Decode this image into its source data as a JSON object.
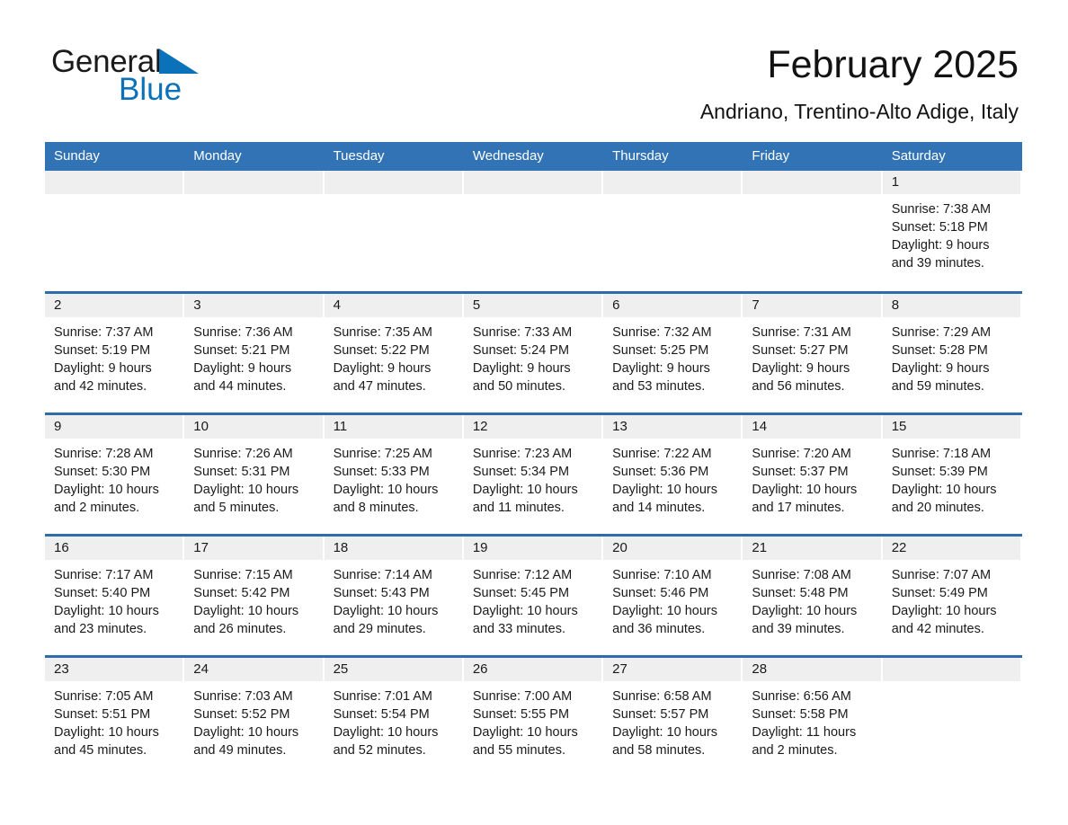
{
  "brand": {
    "name_part1": "General",
    "name_part2": "Blue",
    "triangle_color": "#0b71b8"
  },
  "header": {
    "title": "February 2025",
    "subtitle": "Andriano, Trentino-Alto Adige, Italy",
    "accent_color": "#3273b5",
    "row_rule_color": "#2e6da9",
    "daynum_band_color": "#efeff0"
  },
  "weekday_headers": [
    "Sunday",
    "Monday",
    "Tuesday",
    "Wednesday",
    "Thursday",
    "Friday",
    "Saturday"
  ],
  "labels": {
    "sunrise_prefix": "Sunrise:",
    "sunset_prefix": "Sunset:",
    "daylight_prefix": "Daylight:"
  },
  "weeks": [
    [
      {
        "blank": true
      },
      {
        "blank": true
      },
      {
        "blank": true
      },
      {
        "blank": true
      },
      {
        "blank": true
      },
      {
        "blank": true
      },
      {
        "day": "1",
        "sunrise": "Sunrise: 7:38 AM",
        "sunset": "Sunset: 5:18 PM",
        "daylight1": "Daylight: 9 hours",
        "daylight2": "and 39 minutes."
      }
    ],
    [
      {
        "day": "2",
        "sunrise": "Sunrise: 7:37 AM",
        "sunset": "Sunset: 5:19 PM",
        "daylight1": "Daylight: 9 hours",
        "daylight2": "and 42 minutes."
      },
      {
        "day": "3",
        "sunrise": "Sunrise: 7:36 AM",
        "sunset": "Sunset: 5:21 PM",
        "daylight1": "Daylight: 9 hours",
        "daylight2": "and 44 minutes."
      },
      {
        "day": "4",
        "sunrise": "Sunrise: 7:35 AM",
        "sunset": "Sunset: 5:22 PM",
        "daylight1": "Daylight: 9 hours",
        "daylight2": "and 47 minutes."
      },
      {
        "day": "5",
        "sunrise": "Sunrise: 7:33 AM",
        "sunset": "Sunset: 5:24 PM",
        "daylight1": "Daylight: 9 hours",
        "daylight2": "and 50 minutes."
      },
      {
        "day": "6",
        "sunrise": "Sunrise: 7:32 AM",
        "sunset": "Sunset: 5:25 PM",
        "daylight1": "Daylight: 9 hours",
        "daylight2": "and 53 minutes."
      },
      {
        "day": "7",
        "sunrise": "Sunrise: 7:31 AM",
        "sunset": "Sunset: 5:27 PM",
        "daylight1": "Daylight: 9 hours",
        "daylight2": "and 56 minutes."
      },
      {
        "day": "8",
        "sunrise": "Sunrise: 7:29 AM",
        "sunset": "Sunset: 5:28 PM",
        "daylight1": "Daylight: 9 hours",
        "daylight2": "and 59 minutes."
      }
    ],
    [
      {
        "day": "9",
        "sunrise": "Sunrise: 7:28 AM",
        "sunset": "Sunset: 5:30 PM",
        "daylight1": "Daylight: 10 hours",
        "daylight2": "and 2 minutes."
      },
      {
        "day": "10",
        "sunrise": "Sunrise: 7:26 AM",
        "sunset": "Sunset: 5:31 PM",
        "daylight1": "Daylight: 10 hours",
        "daylight2": "and 5 minutes."
      },
      {
        "day": "11",
        "sunrise": "Sunrise: 7:25 AM",
        "sunset": "Sunset: 5:33 PM",
        "daylight1": "Daylight: 10 hours",
        "daylight2": "and 8 minutes."
      },
      {
        "day": "12",
        "sunrise": "Sunrise: 7:23 AM",
        "sunset": "Sunset: 5:34 PM",
        "daylight1": "Daylight: 10 hours",
        "daylight2": "and 11 minutes."
      },
      {
        "day": "13",
        "sunrise": "Sunrise: 7:22 AM",
        "sunset": "Sunset: 5:36 PM",
        "daylight1": "Daylight: 10 hours",
        "daylight2": "and 14 minutes."
      },
      {
        "day": "14",
        "sunrise": "Sunrise: 7:20 AM",
        "sunset": "Sunset: 5:37 PM",
        "daylight1": "Daylight: 10 hours",
        "daylight2": "and 17 minutes."
      },
      {
        "day": "15",
        "sunrise": "Sunrise: 7:18 AM",
        "sunset": "Sunset: 5:39 PM",
        "daylight1": "Daylight: 10 hours",
        "daylight2": "and 20 minutes."
      }
    ],
    [
      {
        "day": "16",
        "sunrise": "Sunrise: 7:17 AM",
        "sunset": "Sunset: 5:40 PM",
        "daylight1": "Daylight: 10 hours",
        "daylight2": "and 23 minutes."
      },
      {
        "day": "17",
        "sunrise": "Sunrise: 7:15 AM",
        "sunset": "Sunset: 5:42 PM",
        "daylight1": "Daylight: 10 hours",
        "daylight2": "and 26 minutes."
      },
      {
        "day": "18",
        "sunrise": "Sunrise: 7:14 AM",
        "sunset": "Sunset: 5:43 PM",
        "daylight1": "Daylight: 10 hours",
        "daylight2": "and 29 minutes."
      },
      {
        "day": "19",
        "sunrise": "Sunrise: 7:12 AM",
        "sunset": "Sunset: 5:45 PM",
        "daylight1": "Daylight: 10 hours",
        "daylight2": "and 33 minutes."
      },
      {
        "day": "20",
        "sunrise": "Sunrise: 7:10 AM",
        "sunset": "Sunset: 5:46 PM",
        "daylight1": "Daylight: 10 hours",
        "daylight2": "and 36 minutes."
      },
      {
        "day": "21",
        "sunrise": "Sunrise: 7:08 AM",
        "sunset": "Sunset: 5:48 PM",
        "daylight1": "Daylight: 10 hours",
        "daylight2": "and 39 minutes."
      },
      {
        "day": "22",
        "sunrise": "Sunrise: 7:07 AM",
        "sunset": "Sunset: 5:49 PM",
        "daylight1": "Daylight: 10 hours",
        "daylight2": "and 42 minutes."
      }
    ],
    [
      {
        "day": "23",
        "sunrise": "Sunrise: 7:05 AM",
        "sunset": "Sunset: 5:51 PM",
        "daylight1": "Daylight: 10 hours",
        "daylight2": "and 45 minutes."
      },
      {
        "day": "24",
        "sunrise": "Sunrise: 7:03 AM",
        "sunset": "Sunset: 5:52 PM",
        "daylight1": "Daylight: 10 hours",
        "daylight2": "and 49 minutes."
      },
      {
        "day": "25",
        "sunrise": "Sunrise: 7:01 AM",
        "sunset": "Sunset: 5:54 PM",
        "daylight1": "Daylight: 10 hours",
        "daylight2": "and 52 minutes."
      },
      {
        "day": "26",
        "sunrise": "Sunrise: 7:00 AM",
        "sunset": "Sunset: 5:55 PM",
        "daylight1": "Daylight: 10 hours",
        "daylight2": "and 55 minutes."
      },
      {
        "day": "27",
        "sunrise": "Sunrise: 6:58 AM",
        "sunset": "Sunset: 5:57 PM",
        "daylight1": "Daylight: 10 hours",
        "daylight2": "and 58 minutes."
      },
      {
        "day": "28",
        "sunrise": "Sunrise: 6:56 AM",
        "sunset": "Sunset: 5:58 PM",
        "daylight1": "Daylight: 11 hours",
        "daylight2": "and 2 minutes."
      },
      {
        "blank": true
      }
    ]
  ]
}
